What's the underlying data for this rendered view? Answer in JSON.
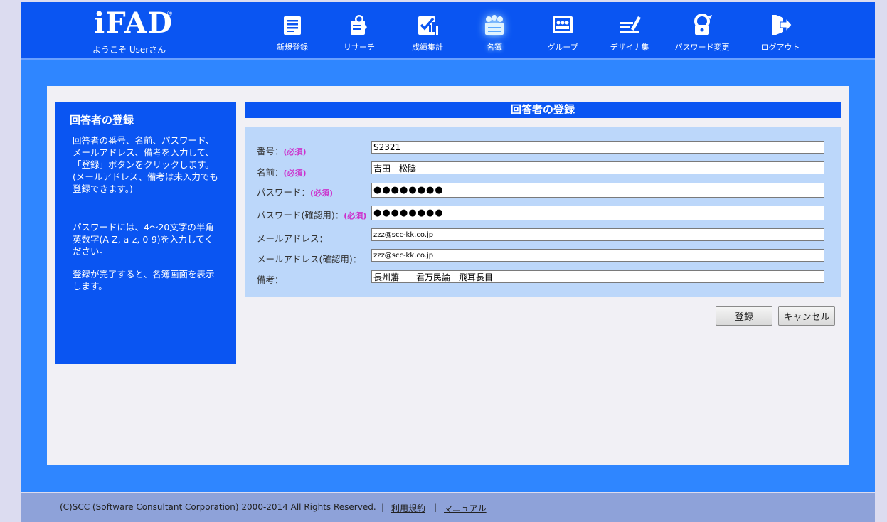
{
  "header": {
    "brand": "iFAD",
    "reg_mark": "®",
    "welcome": "ようこそ Userさん",
    "nav": [
      {
        "label": "新規登録"
      },
      {
        "label": "リサーチ"
      },
      {
        "label": "成績集計"
      },
      {
        "label": "名簿",
        "active": true
      },
      {
        "label": "グループ"
      },
      {
        "label": "デザイナ集"
      },
      {
        "label": "パスワード変更"
      },
      {
        "label": "ログアウト"
      }
    ]
  },
  "side": {
    "title": "回答者の登録",
    "para1": "回答者の番号、名前、パスワード、メールアドレス、備考を入力して、「登録」ボタンをクリックします。(メールアドレス、備考は未入力でも登録できます。)",
    "para2": "パスワードには、4〜20文字の半角英数字(A-Z, a-z, 0-9)を入力してください。",
    "para3": "登録が完了すると、名簿画面を表示します。"
  },
  "form": {
    "title": "回答者の登録",
    "required_tag": "(必須)",
    "fields": [
      {
        "label": "番号：",
        "value": "S2321",
        "required": true
      },
      {
        "label": "名前：",
        "value": "吉田　松陰",
        "required": true
      },
      {
        "label": "パスワード：",
        "value": "●●●●●●●●",
        "required": true
      },
      {
        "label": "パスワード(確認用)：",
        "value": "●●●●●●●●",
        "required": true
      },
      {
        "label": "メールアドレス：",
        "value": "zzz@scc-kk.co.jp",
        "required": false
      },
      {
        "label": "メールアドレス(確認用)：",
        "value": "zzz@scc-kk.co.jp",
        "required": false
      },
      {
        "label": "備考：",
        "value": "長州藩　一君万民論　飛耳長目",
        "required": false
      }
    ],
    "submit_label": "登録",
    "cancel_label": "キャンセル"
  },
  "footer": {
    "copyright": "(C)SCC (Software Consultant Corporation) 2000-2014 All Rights Reserved.",
    "separator": "|",
    "terms_link": "利用規約",
    "manual_link": "マニュアル"
  },
  "colors": {
    "header_bg": "#0a55f2",
    "band_bg": "#2f86ff",
    "form_bg": "#bcd7fa",
    "required_color": "#cc33cc",
    "footer_bg": "#8ea2d9"
  },
  "icons": [
    "new-registration-icon",
    "research-icon",
    "grades-icon",
    "roster-icon",
    "group-icon",
    "designer-icon",
    "password-change-icon",
    "logout-icon"
  ]
}
